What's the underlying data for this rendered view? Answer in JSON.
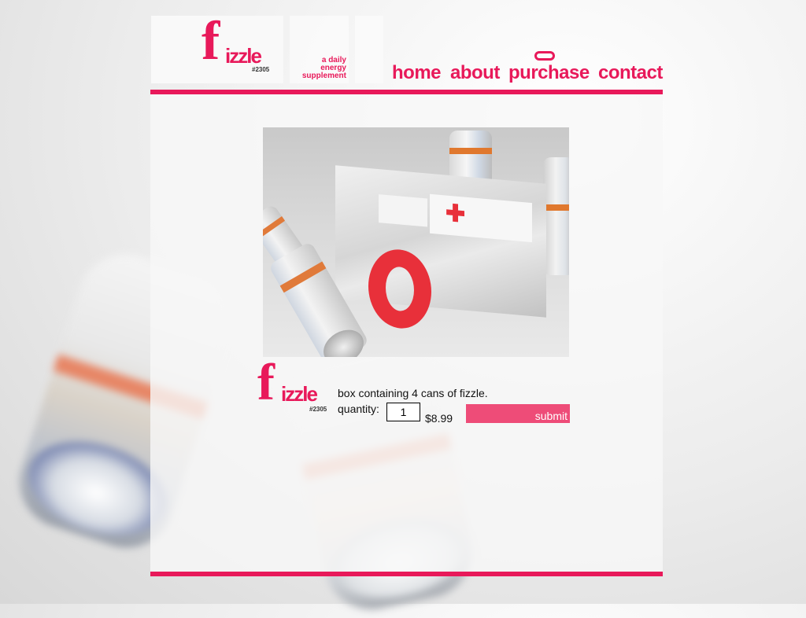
{
  "brand": {
    "logo_word": "izzle",
    "logo_initial": "f",
    "logo_number": "#2305",
    "tagline": [
      "a daily",
      "energy",
      "supplement"
    ]
  },
  "nav": {
    "items": [
      "home",
      "about",
      "purchase",
      "contact"
    ],
    "active": "purchase"
  },
  "product": {
    "description": "box containing 4 cans of fizzle.",
    "quantity_label": "quantity:",
    "quantity_value": "1",
    "price": "$8.99",
    "submit_label": "submit"
  },
  "theme": {
    "accent": "#e8195a",
    "button": "#ee4c78"
  }
}
